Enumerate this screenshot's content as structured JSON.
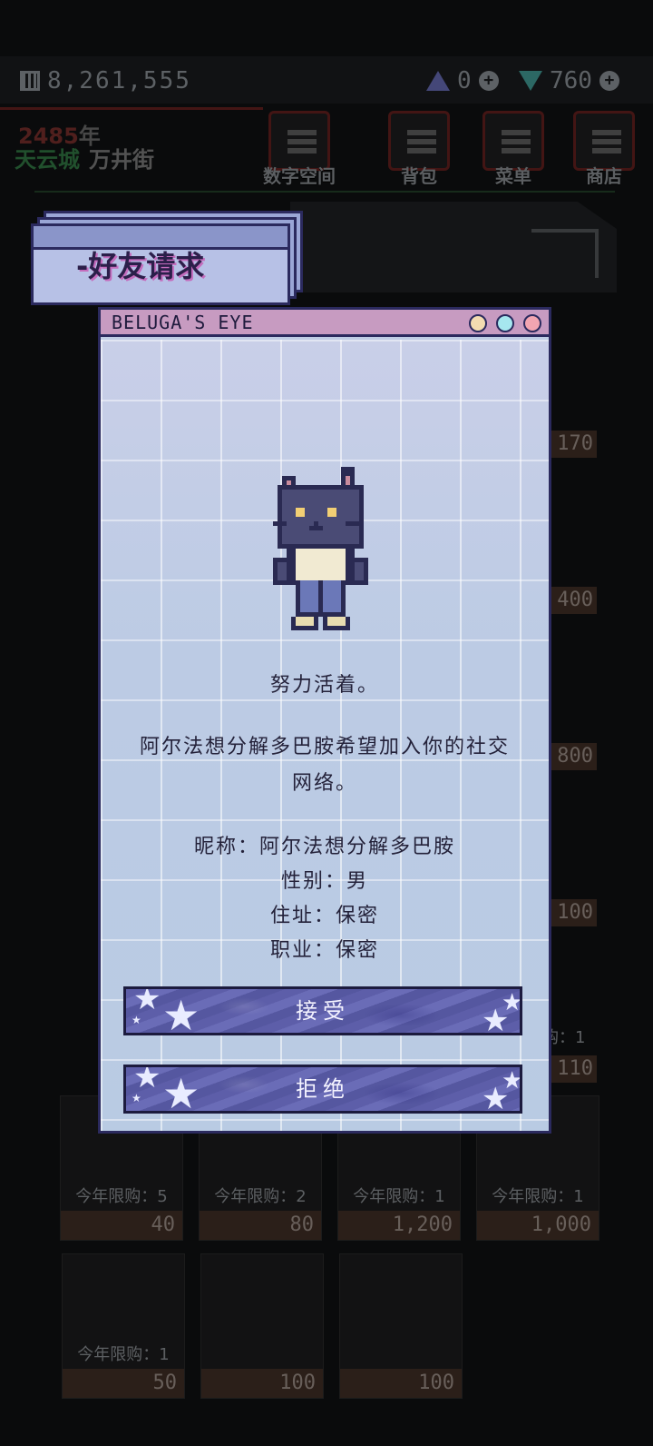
{
  "hud": {
    "money": "8,261,555",
    "currency_a": "0",
    "currency_b": "760",
    "year": "2485",
    "year_unit": "年",
    "city": "天云城",
    "street": "万井街"
  },
  "nav": [
    {
      "label": "数字空间"
    },
    {
      "label": "背包"
    },
    {
      "label": "菜单"
    },
    {
      "label": "商店"
    }
  ],
  "shop": {
    "side_prices": [
      "170",
      "400",
      "800",
      "100",
      "110"
    ],
    "side_limit": "购：1",
    "row1": [
      {
        "limit": "今年限购：5",
        "price": "40"
      },
      {
        "limit": "今年限购：2",
        "price": "80"
      },
      {
        "limit": "今年限购：1",
        "price": "1,200"
      },
      {
        "limit": "今年限购：1",
        "price": "1,000"
      }
    ],
    "row2": [
      {
        "limit": "今年限购：1",
        "price": "50"
      },
      {
        "limit": "",
        "price": "100"
      },
      {
        "limit": "",
        "price": "100"
      }
    ]
  },
  "dialog": {
    "tag_title": "-好友请求",
    "window_title": "BELUGA'S EYE",
    "status": "努力活着。",
    "request": "阿尔法想分解多巴胺希望加入你的社交网络。",
    "nickname": "昵称：阿尔法想分解多巴胺",
    "gender": "性别：男",
    "address": "住址：保密",
    "job": "职业：保密",
    "accept": "接受",
    "reject": "拒绝"
  },
  "colors": {
    "window_border": "#2b2a5e",
    "titlebar": "#c79bc1",
    "button": "#5d5ea9"
  }
}
